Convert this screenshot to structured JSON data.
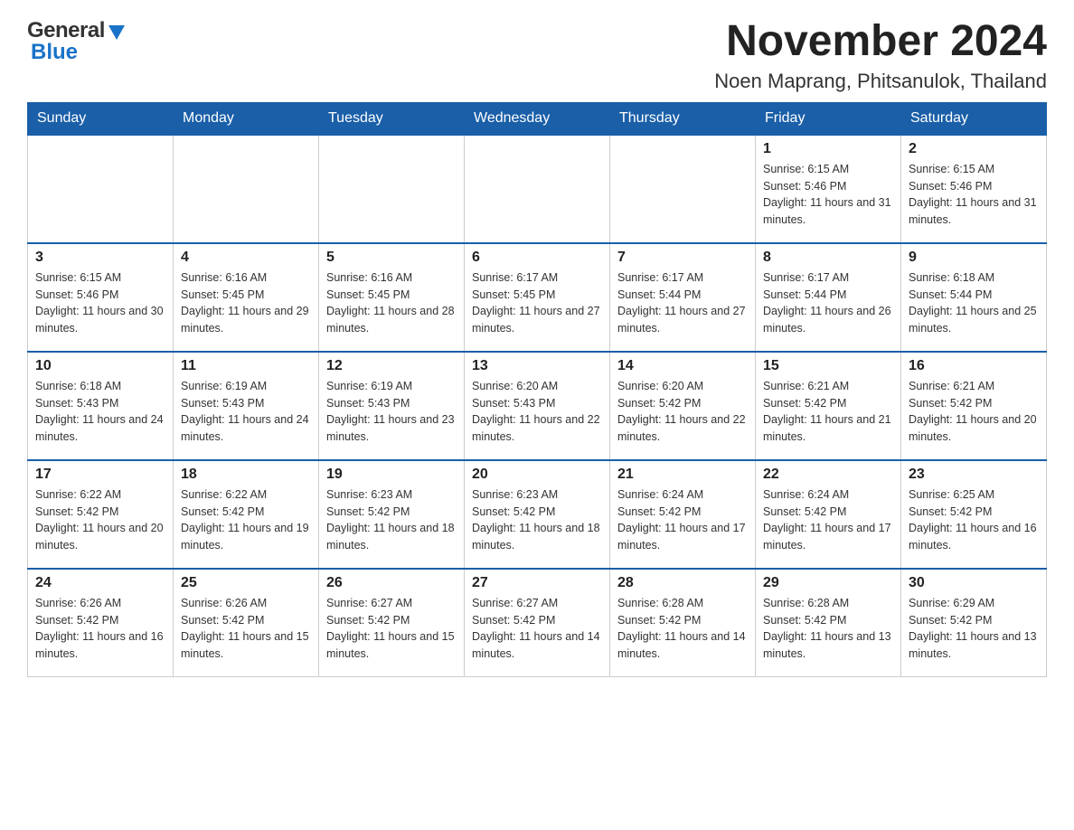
{
  "header": {
    "logo_general": "General",
    "logo_blue": "Blue",
    "month_title": "November 2024",
    "location": "Noen Maprang, Phitsanulok, Thailand"
  },
  "days_of_week": [
    "Sunday",
    "Monday",
    "Tuesday",
    "Wednesday",
    "Thursday",
    "Friday",
    "Saturday"
  ],
  "weeks": [
    [
      {
        "day": "",
        "info": ""
      },
      {
        "day": "",
        "info": ""
      },
      {
        "day": "",
        "info": ""
      },
      {
        "day": "",
        "info": ""
      },
      {
        "day": "",
        "info": ""
      },
      {
        "day": "1",
        "info": "Sunrise: 6:15 AM\nSunset: 5:46 PM\nDaylight: 11 hours and 31 minutes."
      },
      {
        "day": "2",
        "info": "Sunrise: 6:15 AM\nSunset: 5:46 PM\nDaylight: 11 hours and 31 minutes."
      }
    ],
    [
      {
        "day": "3",
        "info": "Sunrise: 6:15 AM\nSunset: 5:46 PM\nDaylight: 11 hours and 30 minutes."
      },
      {
        "day": "4",
        "info": "Sunrise: 6:16 AM\nSunset: 5:45 PM\nDaylight: 11 hours and 29 minutes."
      },
      {
        "day": "5",
        "info": "Sunrise: 6:16 AM\nSunset: 5:45 PM\nDaylight: 11 hours and 28 minutes."
      },
      {
        "day": "6",
        "info": "Sunrise: 6:17 AM\nSunset: 5:45 PM\nDaylight: 11 hours and 27 minutes."
      },
      {
        "day": "7",
        "info": "Sunrise: 6:17 AM\nSunset: 5:44 PM\nDaylight: 11 hours and 27 minutes."
      },
      {
        "day": "8",
        "info": "Sunrise: 6:17 AM\nSunset: 5:44 PM\nDaylight: 11 hours and 26 minutes."
      },
      {
        "day": "9",
        "info": "Sunrise: 6:18 AM\nSunset: 5:44 PM\nDaylight: 11 hours and 25 minutes."
      }
    ],
    [
      {
        "day": "10",
        "info": "Sunrise: 6:18 AM\nSunset: 5:43 PM\nDaylight: 11 hours and 24 minutes."
      },
      {
        "day": "11",
        "info": "Sunrise: 6:19 AM\nSunset: 5:43 PM\nDaylight: 11 hours and 24 minutes."
      },
      {
        "day": "12",
        "info": "Sunrise: 6:19 AM\nSunset: 5:43 PM\nDaylight: 11 hours and 23 minutes."
      },
      {
        "day": "13",
        "info": "Sunrise: 6:20 AM\nSunset: 5:43 PM\nDaylight: 11 hours and 22 minutes."
      },
      {
        "day": "14",
        "info": "Sunrise: 6:20 AM\nSunset: 5:42 PM\nDaylight: 11 hours and 22 minutes."
      },
      {
        "day": "15",
        "info": "Sunrise: 6:21 AM\nSunset: 5:42 PM\nDaylight: 11 hours and 21 minutes."
      },
      {
        "day": "16",
        "info": "Sunrise: 6:21 AM\nSunset: 5:42 PM\nDaylight: 11 hours and 20 minutes."
      }
    ],
    [
      {
        "day": "17",
        "info": "Sunrise: 6:22 AM\nSunset: 5:42 PM\nDaylight: 11 hours and 20 minutes."
      },
      {
        "day": "18",
        "info": "Sunrise: 6:22 AM\nSunset: 5:42 PM\nDaylight: 11 hours and 19 minutes."
      },
      {
        "day": "19",
        "info": "Sunrise: 6:23 AM\nSunset: 5:42 PM\nDaylight: 11 hours and 18 minutes."
      },
      {
        "day": "20",
        "info": "Sunrise: 6:23 AM\nSunset: 5:42 PM\nDaylight: 11 hours and 18 minutes."
      },
      {
        "day": "21",
        "info": "Sunrise: 6:24 AM\nSunset: 5:42 PM\nDaylight: 11 hours and 17 minutes."
      },
      {
        "day": "22",
        "info": "Sunrise: 6:24 AM\nSunset: 5:42 PM\nDaylight: 11 hours and 17 minutes."
      },
      {
        "day": "23",
        "info": "Sunrise: 6:25 AM\nSunset: 5:42 PM\nDaylight: 11 hours and 16 minutes."
      }
    ],
    [
      {
        "day": "24",
        "info": "Sunrise: 6:26 AM\nSunset: 5:42 PM\nDaylight: 11 hours and 16 minutes."
      },
      {
        "day": "25",
        "info": "Sunrise: 6:26 AM\nSunset: 5:42 PM\nDaylight: 11 hours and 15 minutes."
      },
      {
        "day": "26",
        "info": "Sunrise: 6:27 AM\nSunset: 5:42 PM\nDaylight: 11 hours and 15 minutes."
      },
      {
        "day": "27",
        "info": "Sunrise: 6:27 AM\nSunset: 5:42 PM\nDaylight: 11 hours and 14 minutes."
      },
      {
        "day": "28",
        "info": "Sunrise: 6:28 AM\nSunset: 5:42 PM\nDaylight: 11 hours and 14 minutes."
      },
      {
        "day": "29",
        "info": "Sunrise: 6:28 AM\nSunset: 5:42 PM\nDaylight: 11 hours and 13 minutes."
      },
      {
        "day": "30",
        "info": "Sunrise: 6:29 AM\nSunset: 5:42 PM\nDaylight: 11 hours and 13 minutes."
      }
    ]
  ]
}
